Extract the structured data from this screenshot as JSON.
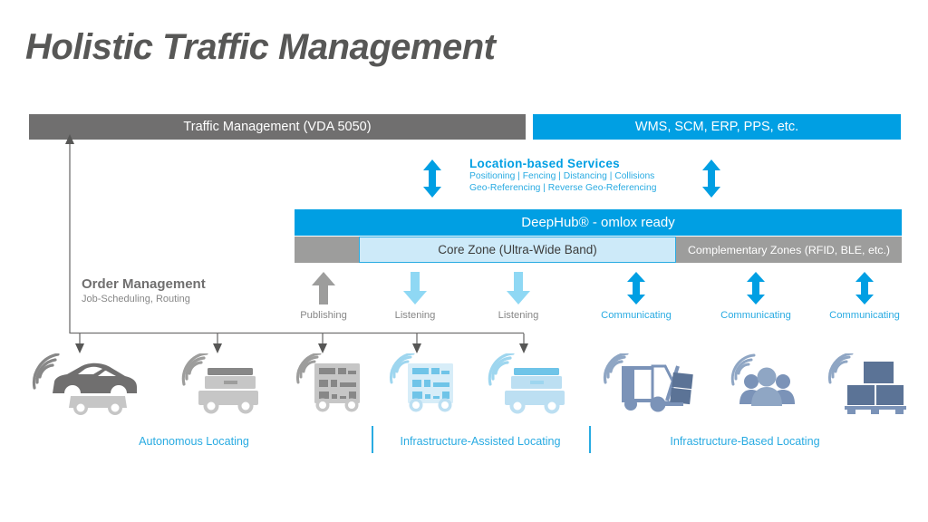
{
  "title": "Holistic Traffic Management",
  "top_bars": {
    "traffic_management": "Traffic Management (VDA 5050)",
    "enterprise_systems": "WMS, SCM, ERP, PPS, etc."
  },
  "location_based_services": {
    "heading": "Location-based Services",
    "line1": "Positioning | Fencing | Distancing | Collisions",
    "line2": "Geo-Referencing | Reverse Geo-Referencing",
    "left_arrow_icon": "double-arrow-vertical-icon",
    "right_arrow_icon": "double-arrow-vertical-icon"
  },
  "deephub": {
    "title": "DeepHub® - omlox ready",
    "core_zone": "Core Zone (Ultra-Wide Band)",
    "complementary_zones": "Complementary Zones (RFID, BLE, etc.)"
  },
  "order_management": {
    "title": "Order Management",
    "subtitle": "Job-Scheduling, Routing"
  },
  "flows": [
    {
      "label": "Publishing",
      "arrow": "arrow-up-icon",
      "color": "#9D9D9C",
      "style": "gray"
    },
    {
      "label": "Listening",
      "arrow": "arrow-down-icon",
      "color": "#8FD8F4",
      "style": "lightblue"
    },
    {
      "label": "Listening",
      "arrow": "arrow-down-icon",
      "color": "#8FD8F4",
      "style": "lightblue"
    },
    {
      "label": "Communicating",
      "arrow": "double-arrow-vertical-icon",
      "color": "#009FE3",
      "style": "blue"
    },
    {
      "label": "Communicating",
      "arrow": "double-arrow-vertical-icon",
      "color": "#009FE3",
      "style": "blue"
    },
    {
      "label": "Communicating",
      "arrow": "double-arrow-vertical-icon",
      "color": "#009FE3",
      "style": "blue"
    }
  ],
  "vehicles": [
    {
      "icon": "car-icon",
      "color": "#706F6F"
    },
    {
      "icon": "agv-cart-icon",
      "color": "#C6C6C6"
    },
    {
      "icon": "shelf-robot-icon",
      "color": "#C6C6C6"
    },
    {
      "icon": "shelf-robot-icon",
      "color": "#BCDFF2"
    },
    {
      "icon": "agv-cart-icon",
      "color": "#BCDFF2"
    },
    {
      "icon": "forklift-icon",
      "color": "#7B93B8"
    },
    {
      "icon": "people-group-icon",
      "color": "#7B93B8"
    },
    {
      "icon": "pallet-boxes-icon",
      "color": "#7B93B8"
    }
  ],
  "categories": [
    {
      "label": "Autonomous Locating"
    },
    {
      "label": "Infrastructure-Assisted Locating"
    },
    {
      "label": "Infrastructure-Based Locating"
    }
  ],
  "colors": {
    "brand_blue": "#009FE3",
    "light_blue": "#29ABE2",
    "pale_blue": "#CDEAF9",
    "dark_gray": "#706F6F",
    "mid_gray": "#9D9D9C",
    "steel_blue": "#7B93B8"
  }
}
